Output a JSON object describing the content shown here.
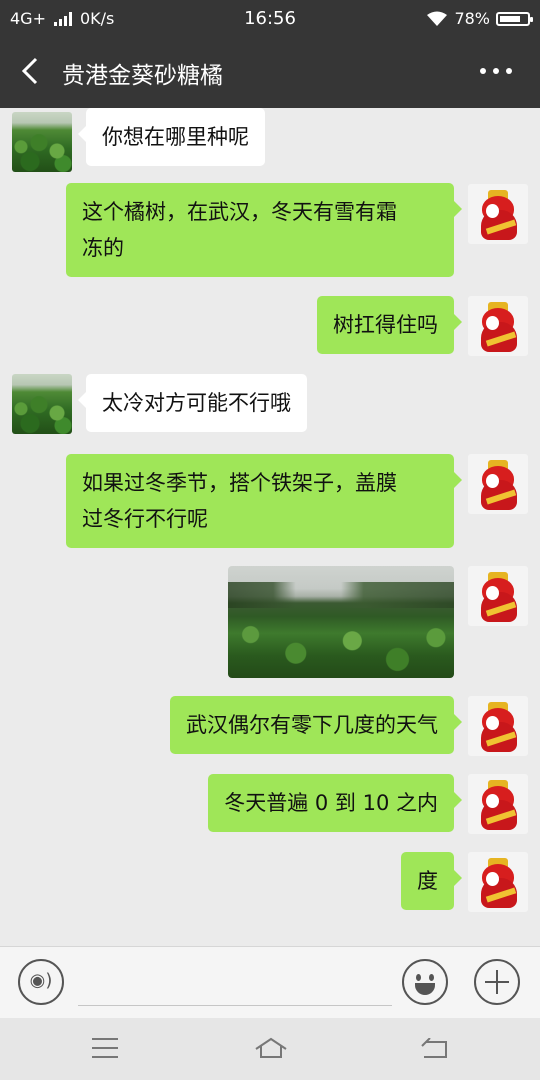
{
  "status_bar": {
    "network": "4G+",
    "speed": "0K/s",
    "time": "16:56",
    "battery": "78%",
    "battery_level": 0.78
  },
  "header": {
    "title": "贵港金葵砂糖橘",
    "back_icon": "chevron-left-icon",
    "more_icon": "more-dots-icon"
  },
  "messages": [
    {
      "side": "left",
      "type": "text",
      "text": "你想在哪里种呢"
    },
    {
      "side": "right",
      "type": "text",
      "lines": [
        "这个橘树，在武汉，冬天有雪有霜",
        "冻的"
      ]
    },
    {
      "side": "right",
      "type": "text",
      "text": "树扛得住吗"
    },
    {
      "side": "left",
      "type": "text",
      "text": "太冷对方可能不行哦"
    },
    {
      "side": "right",
      "type": "text",
      "lines": [
        "如果过冬季节，搭个铁架子，盖膜",
        "过冬行不行呢"
      ]
    },
    {
      "side": "right",
      "type": "image",
      "description_icon": "orchard-photo"
    },
    {
      "side": "right",
      "type": "text",
      "text": "武汉偶尔有零下几度的天气"
    },
    {
      "side": "right",
      "type": "text",
      "text": "冬天普遍 0 到 10 之内"
    },
    {
      "side": "right",
      "type": "text",
      "text": "度"
    }
  ],
  "input_bar": {
    "voice_icon": "voice-icon",
    "emoji_icon": "emoji-icon",
    "plus_icon": "plus-icon",
    "voice_symbol": "◉)"
  },
  "nav_bar": {
    "menu_icon": "menu-icon",
    "home_icon": "home-icon",
    "back_icon": "back-icon"
  },
  "colors": {
    "header_bg": "#363636",
    "chat_bg": "#ebebeb",
    "own_bubble": "#9fe658",
    "other_bubble": "#ffffff"
  }
}
